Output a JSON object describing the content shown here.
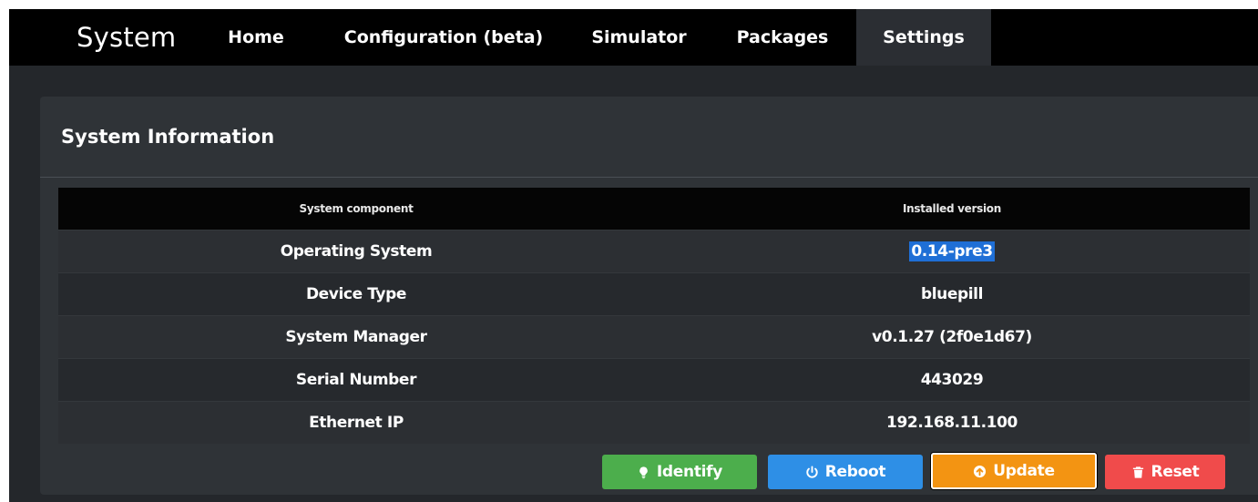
{
  "nav": {
    "brand": "System",
    "items": [
      {
        "label": "Home",
        "active": false
      },
      {
        "label": "Configuration (beta)",
        "active": false
      },
      {
        "label": "Simulator",
        "active": false
      },
      {
        "label": "Packages",
        "active": false
      },
      {
        "label": "Settings",
        "active": true
      }
    ]
  },
  "panel": {
    "title": "System Information",
    "table": {
      "headers": [
        "System component",
        "Installed version"
      ],
      "rows": [
        {
          "component": "Operating System",
          "version": "0.14-pre3",
          "version_selected": true
        },
        {
          "component": "Device Type",
          "version": "bluepill"
        },
        {
          "component": "System Manager",
          "version": "v0.1.27 (2f0e1d67)"
        },
        {
          "component": "Serial Number",
          "version": "443029"
        },
        {
          "component": "Ethernet IP",
          "version": "192.168.11.100"
        }
      ]
    }
  },
  "actions": {
    "identify": {
      "label": "Identify",
      "icon": "lightbulb-icon",
      "color": "#4cae4c"
    },
    "reboot": {
      "label": "Reboot",
      "icon": "power-icon",
      "color": "#2e8fe6"
    },
    "update": {
      "label": "Update",
      "icon": "upload-circle-icon",
      "color": "#f39412"
    },
    "reset": {
      "label": "Reset",
      "icon": "trash-icon",
      "color": "#f04b4b"
    }
  }
}
